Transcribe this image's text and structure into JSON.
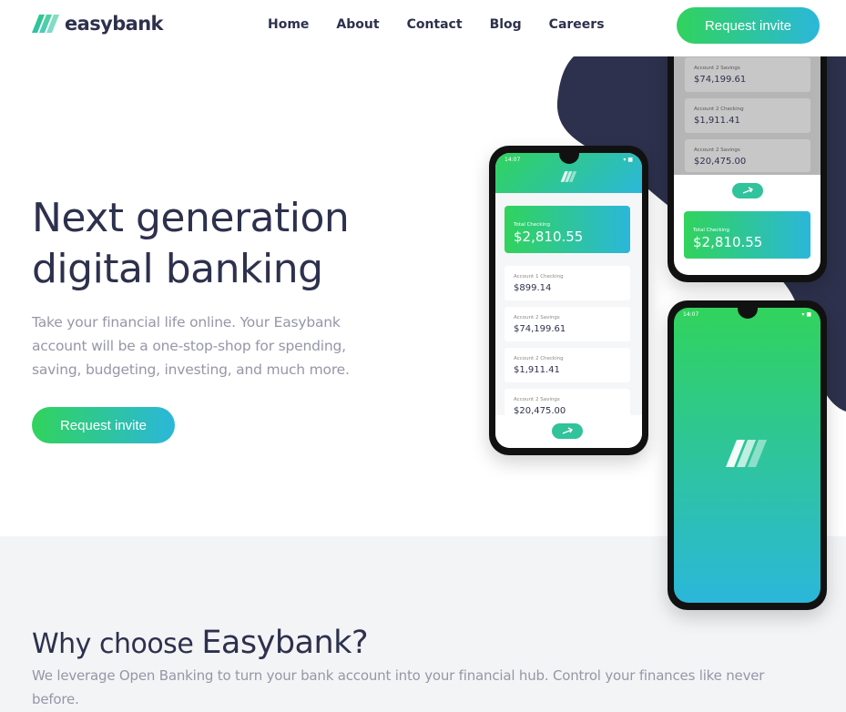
{
  "brand": {
    "name": "easybank",
    "colors": {
      "navy": "#2d314d",
      "lime_green": "#31d35c",
      "bright_cyan": "#2bb7da",
      "grayish_blue": "#9597a7",
      "light_gray": "#f3f4f6"
    }
  },
  "nav": {
    "items": [
      "Home",
      "About",
      "Contact",
      "Blog",
      "Careers"
    ],
    "cta_label": "Request invite"
  },
  "hero": {
    "title_line1": "Next generation",
    "title_line2": "digital banking",
    "description": "Take your financial life online. Your Easybank account will be a one-stop-shop for spending, saving, budgeting, investing, and much more.",
    "cta_label": "Request invite",
    "mockups": {
      "status_time": "14:07",
      "total_label": "Total Checking",
      "total_amount": "$2,810.55",
      "accounts": [
        {
          "label": "Account 1 Checking",
          "amount": "$899.14"
        },
        {
          "label": "Account 2 Savings",
          "amount": "$74,199.61"
        },
        {
          "label": "Account 2 Checking",
          "amount": "$1,911.41"
        },
        {
          "label": "Account 2 Savings",
          "amount": "$20,475.00"
        }
      ]
    }
  },
  "why": {
    "title_part1": "Why choose ",
    "title_part2": "Easybank?",
    "description": "We leverage Open Banking to turn your bank account into your financial hub. Control your finances like never before."
  }
}
